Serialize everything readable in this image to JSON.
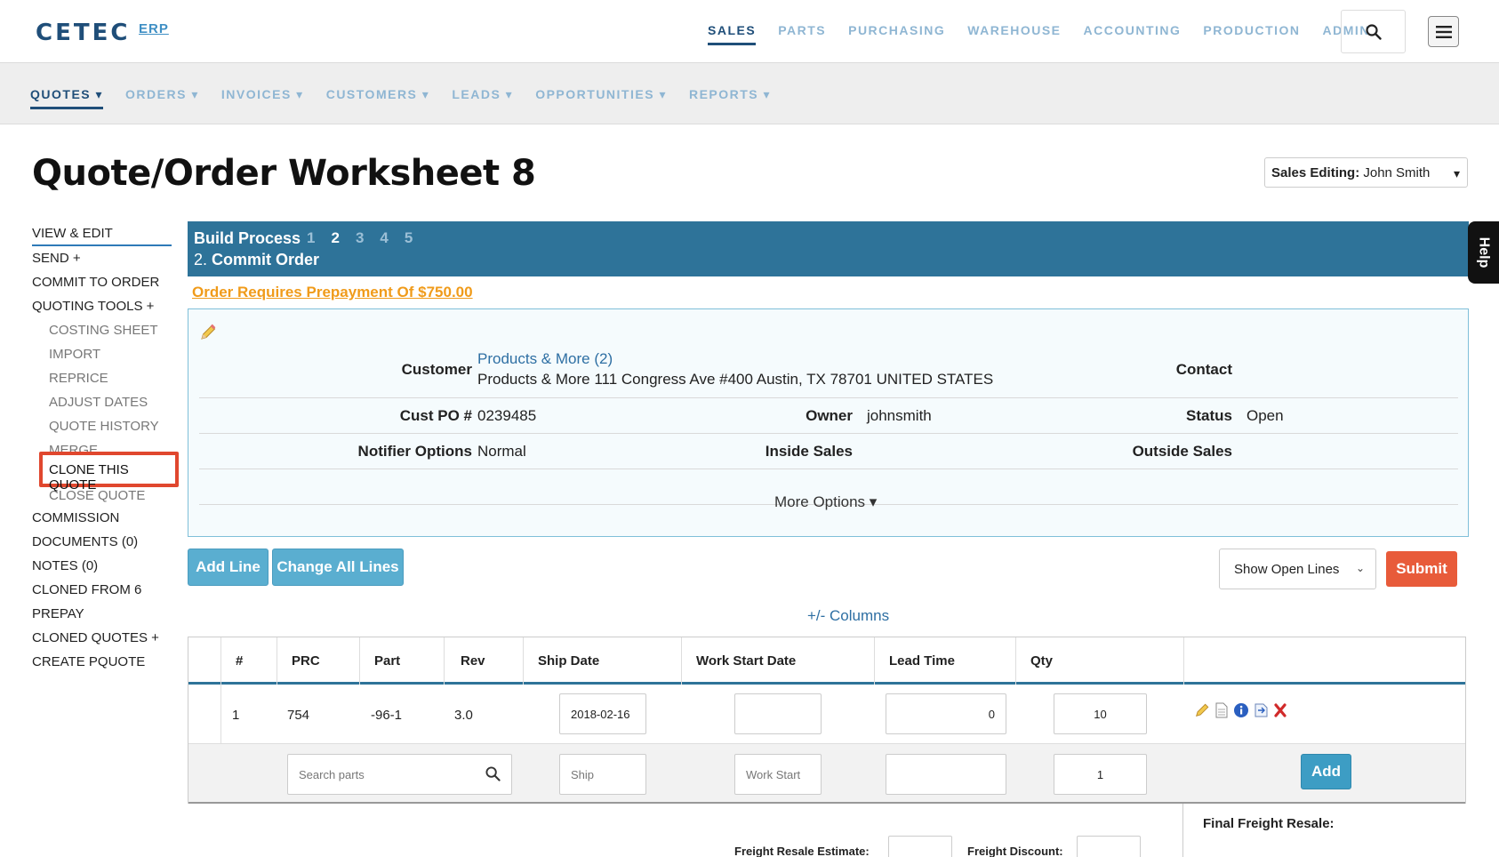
{
  "app": {
    "logo": "CETEC",
    "logo_sub": "ERP"
  },
  "topnav": [
    "SALES",
    "PARTS",
    "PURCHASING",
    "WAREHOUSE",
    "ACCOUNTING",
    "PRODUCTION",
    "ADMIN"
  ],
  "subnav": [
    "QUOTES ▾",
    "ORDERS ▾",
    "INVOICES ▾",
    "CUSTOMERS ▾",
    "LEADS ▾",
    "OPPORTUNITIES ▾",
    "REPORTS ▾"
  ],
  "page": {
    "title": "Quote/Order Worksheet 8"
  },
  "sales_editing": {
    "label": "Sales Editing:",
    "value": "John Smith",
    "caret": "▾"
  },
  "left_menu": {
    "view_edit": "VIEW & EDIT",
    "send": "SEND +",
    "commit": "COMMIT TO ORDER",
    "quoting_tools": "QUOTING TOOLS +",
    "costing_sheet": "COSTING SHEET",
    "import": "IMPORT",
    "reprice": "REPRICE",
    "adjust_dates": "ADJUST DATES",
    "quote_history": "QUOTE HISTORY",
    "merge": "MERGE",
    "clone": "CLONE THIS QUOTE",
    "close_quote": "CLOSE QUOTE",
    "commission": "COMMISSION",
    "documents": "DOCUMENTS (0)",
    "notes": "NOTES (0)",
    "cloned_from": "CLONED FROM 6",
    "prepay": "PREPAY",
    "cloned_quotes": "CLONED QUOTES +",
    "create_pquote": "CREATE PQUOTE"
  },
  "build_process": {
    "title": "Build Process",
    "steps": [
      "1",
      "2",
      "3",
      "4",
      "5"
    ],
    "current_step": "2",
    "sub_num": "2.",
    "sub_label": "Commit Order"
  },
  "help": "Help",
  "prepayment_notice": "Order Requires Prepayment Of $750.00",
  "info": {
    "customer_label": "Customer",
    "customer_name": "Products & More (2)",
    "customer_address": "Products & More 111 Congress Ave #400 Austin, TX 78701 UNITED STATES",
    "contact_label": "Contact",
    "cust_po_label": "Cust PO #",
    "cust_po": "0239485",
    "owner_label": "Owner",
    "owner": "johnsmith",
    "status_label": "Status",
    "status": "Open",
    "notifier_label": "Notifier Options",
    "notifier": "Normal",
    "inside_sales_label": "Inside Sales",
    "outside_sales_label": "Outside Sales",
    "more_options": "More Options ▾"
  },
  "actions": {
    "add_line": "Add Line",
    "change_all": "Change All Lines",
    "show_filter": "Show Open Lines",
    "submit": "Submit",
    "columns": "+/- Columns"
  },
  "table": {
    "headers": [
      "#",
      "PRC",
      "Part",
      "Rev",
      "Ship Date",
      "Work Start Date",
      "Lead Time",
      "Qty"
    ],
    "rows": [
      {
        "num": "1",
        "prc": "754",
        "part": "-96-1",
        "rev": "3.0",
        "ship_date": "2018-02-16",
        "work_start": "",
        "lead_time": "0",
        "qty": "10"
      }
    ],
    "add_row": {
      "search_placeholder": "Search parts",
      "ship_placeholder": "Ship",
      "work_start_placeholder": "Work Start",
      "qty": "1",
      "add_label": "Add"
    }
  },
  "freight": {
    "final_label": "Final Freight Resale:",
    "estimate_label": "Freight Resale Estimate:",
    "discount_label": "Freight Discount:"
  },
  "colors": {
    "brand": "#1f4e79",
    "accent": "#2e7399",
    "submit": "#e85b3a",
    "warning": "#f09b1a",
    "highlight": "#e0472e"
  }
}
